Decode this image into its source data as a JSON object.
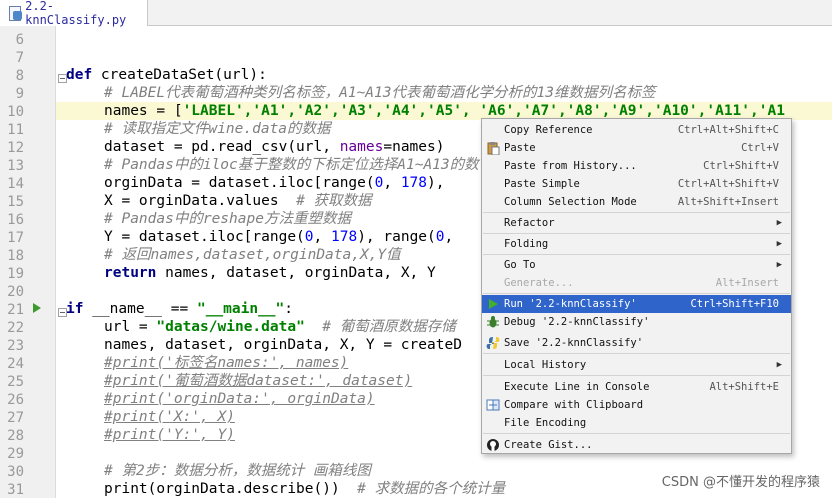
{
  "tab": {
    "title": "2.2-knnClassify.py",
    "close": "×"
  },
  "lines": [
    {
      "n": "6",
      "c": ""
    },
    {
      "n": "7",
      "c": ""
    },
    {
      "n": "8",
      "c": ""
    },
    {
      "n": "9",
      "c": ""
    },
    {
      "n": "10",
      "c": ""
    },
    {
      "n": "11",
      "c": ""
    },
    {
      "n": "12",
      "c": ""
    },
    {
      "n": "13",
      "c": ""
    },
    {
      "n": "14",
      "c": ""
    },
    {
      "n": "15",
      "c": ""
    },
    {
      "n": "16",
      "c": ""
    },
    {
      "n": "17",
      "c": ""
    },
    {
      "n": "18",
      "c": ""
    },
    {
      "n": "19",
      "c": ""
    },
    {
      "n": "20",
      "c": ""
    },
    {
      "n": "21",
      "c": ""
    },
    {
      "n": "22",
      "c": ""
    },
    {
      "n": "23",
      "c": ""
    },
    {
      "n": "24",
      "c": ""
    },
    {
      "n": "25",
      "c": ""
    },
    {
      "n": "26",
      "c": ""
    },
    {
      "n": "27",
      "c": ""
    },
    {
      "n": "28",
      "c": ""
    },
    {
      "n": "29",
      "c": ""
    },
    {
      "n": "30",
      "c": ""
    },
    {
      "n": "31",
      "c": ""
    }
  ],
  "code": {
    "l7_kw": "def",
    "l7_rest": " createDataSet(url):",
    "l8": "# LABEL代表葡萄酒种类列名标签，A1~A13代表葡萄酒化学分析的13维数据列名标签",
    "l9_a": "names = [",
    "l9_b": "'LABEL','A1','A2','A3','A4','A5', 'A6','A7','A8','A9','A10','A11','A1",
    "l10": "# 读取指定文件wine.data的数据",
    "l11_a": "dataset = pd.read_csv(url, ",
    "l11_b": "names",
    "l11_c": "=names)",
    "l12": "# Pandas中的iloc基于整数的下标定位选择A1~A13的数",
    "l13_a": "orginData = dataset.iloc[range(",
    "l13_b": "0",
    "l13_c": ", ",
    "l13_d": "178",
    "l13_e": "),",
    "l14_a": "X = orginData.values  ",
    "l14_b": "# 获取数据",
    "l15": "# Pandas中的reshape方法重塑数据",
    "l16_a": "Y = dataset.iloc[range(",
    "l16_b": "0",
    "l16_c": ", ",
    "l16_d": "178",
    "l16_e": "), range(",
    "l16_f": "0",
    "l16_g": ",",
    "l17": "# 返回names,dataset,orginData,X,Y值",
    "l18_a": "return",
    "l18_b": " names, dataset, orginData, X, Y",
    "l20_a": "if",
    "l20_b": " __name__ == ",
    "l20_c": "\"__main__\"",
    "l20_d": ":",
    "l21_a": "url = ",
    "l21_b": "\"datas/wine.data\"",
    "l21_c": "  ",
    "l21_d": "# 葡萄酒原数据存储",
    "l22": "names, dataset, orginData, X, Y = createD",
    "l23": "#print('标签名names:', names)",
    "l24": "#print('葡萄酒数据dataset:', dataset)",
    "l25": "#print('orginData:', orginData)",
    "l26": "#print('X:', X)",
    "l27": "#print('Y:', Y)",
    "l29": "# 第2步：数据分析，数据统计 画箱线图",
    "l30_a": "print(orginData.describe())  ",
    "l30_b": "# 求数据的各个统计量"
  },
  "menu": {
    "copy_reference": "Copy Reference",
    "copy_reference_sc": "Ctrl+Alt+Shift+C",
    "paste": "Paste",
    "paste_sc": "Ctrl+V",
    "paste_history": "Paste from History...",
    "paste_history_sc": "Ctrl+Shift+V",
    "paste_simple": "Paste Simple",
    "paste_simple_sc": "Ctrl+Alt+Shift+V",
    "column_selection": "Column Selection Mode",
    "column_selection_sc": "Alt+Shift+Insert",
    "refactor": "Refactor",
    "folding": "Folding",
    "goto": "Go To",
    "generate": "Generate...",
    "generate_sc": "Alt+Insert",
    "run": "Run '2.2-knnClassify'",
    "run_sc": "Ctrl+Shift+F10",
    "debug": "Debug '2.2-knnClassify'",
    "save": "Save '2.2-knnClassify'",
    "local_history": "Local History",
    "execute_line": "Execute Line in Console",
    "execute_line_sc": "Alt+Shift+E",
    "compare": "Compare with Clipboard",
    "file_encoding": "File Encoding",
    "create_gist": "Create Gist...",
    "arrow": "▶"
  },
  "watermark": "CSDN @不懂开发的程序猿",
  "colors": {
    "selection": "#2f65ca",
    "keyword": "#000080",
    "string": "#008000",
    "comment": "#808080"
  }
}
